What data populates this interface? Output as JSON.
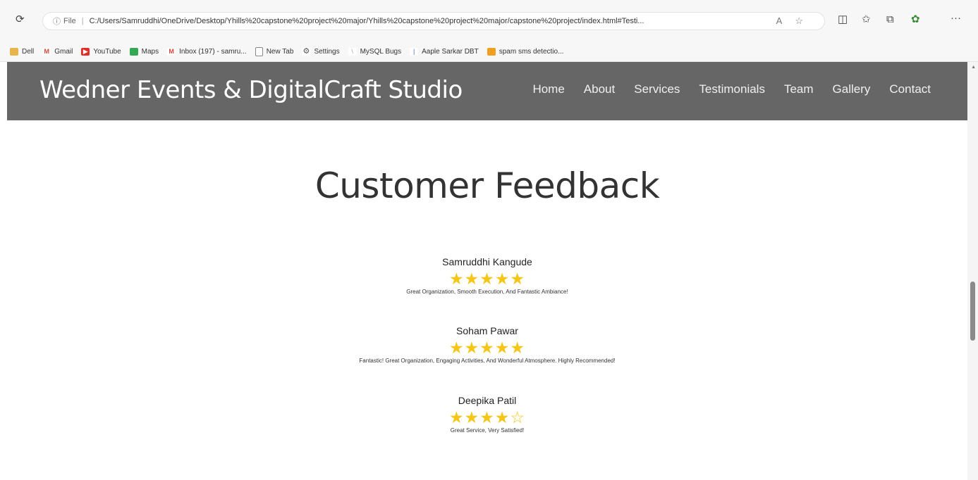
{
  "browser": {
    "reload_icon": "reload-icon",
    "info_icon": "info-icon",
    "file_label": "File",
    "url": "C:/Users/Samruddhi/OneDrive/Desktop/Yhills%20capstone%20project%20major/Yhills%20capstone%20project%20major/capstone%20project/index.html#Testi...",
    "bookmarks": [
      {
        "label": "Dell",
        "color": "#e8b54a"
      },
      {
        "label": "Gmail",
        "color": "#d44638"
      },
      {
        "label": "YouTube",
        "color": "#e52d27"
      },
      {
        "label": "Maps",
        "color": "#34a853"
      },
      {
        "label": "Inbox (197) - samru...",
        "color": "#d44638"
      },
      {
        "label": "New Tab",
        "color": "#9a9a9a"
      },
      {
        "label": "Settings",
        "color": "#7a7a7a"
      },
      {
        "label": "MySQL Bugs",
        "color": "#9aa9b8"
      },
      {
        "label": "Aaple Sarkar DBT",
        "color": "#3b6fb6"
      },
      {
        "label": "spam sms detectio...",
        "color": "#f0a020"
      }
    ]
  },
  "site": {
    "brand": "Wedner Events & DigitalCraft Studio",
    "nav": [
      "Home",
      "About",
      "Services",
      "Testimonials",
      "Team",
      "Gallery",
      "Contact"
    ],
    "nav_bg": "#666666"
  },
  "testimonials": {
    "title": "Customer Feedback",
    "reviews": [
      {
        "name": "Samruddhi Kangude",
        "stars": "★★★★★",
        "rating": 5,
        "text": "Great Organization, Smooth Execution, And Fantastic Ambiance!"
      },
      {
        "name": "Soham Pawar",
        "stars": "★★★★★",
        "rating": 5,
        "text": "Fantastic! Great Organization, Engaging Activities, And Wonderful Atmosphere. Highly Recommended!"
      },
      {
        "name": "Deepika Patil",
        "stars": "★★★★☆",
        "rating": 4,
        "text": "Great Service, Very Satisfied!"
      }
    ],
    "star_color": "#f5c518"
  }
}
